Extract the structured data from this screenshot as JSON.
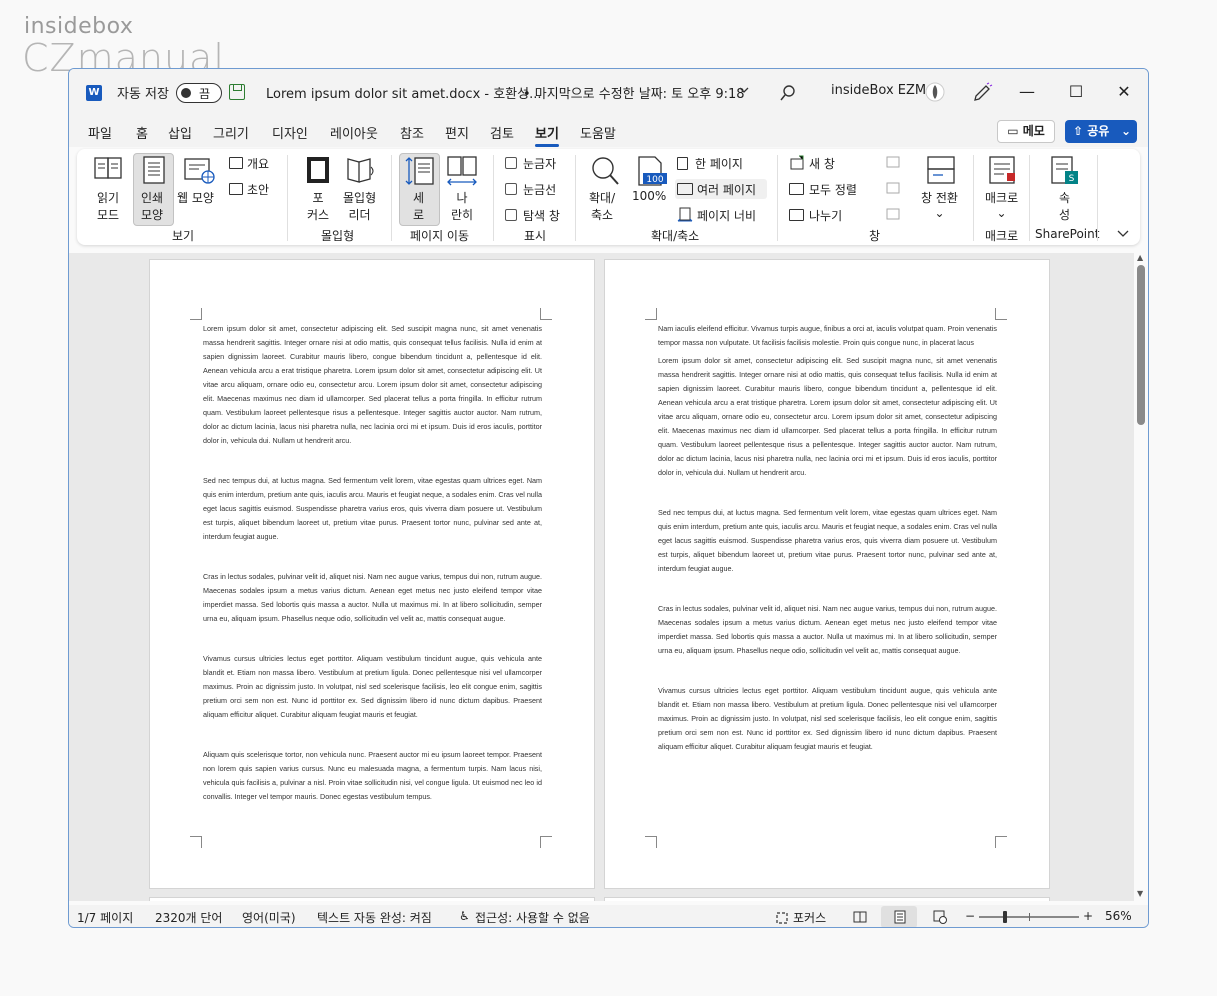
{
  "watermark": {
    "line1": "insidebox",
    "line2": "CZmanual"
  },
  "titlebar": {
    "app_icon": "W",
    "autosave_label": "자동 저장",
    "autosave_state": "끔",
    "doc_title": "Lorem ipsum dolor sit amet.docx  -  호환성...",
    "modified": "•  마지막으로 수정한 날짜: 토 오후 9:18",
    "user": "insideBox EZM",
    "minimize": "—",
    "maximize": "☐",
    "close": "✕"
  },
  "menu": {
    "tabs": [
      "파일",
      "홈",
      "삽입",
      "그리기",
      "디자인",
      "레이아웃",
      "참조",
      "편지",
      "검토",
      "보기",
      "도움말"
    ],
    "active_tab": "보기",
    "memo_label": "메모",
    "share_label": "공유"
  },
  "ribbon": {
    "view": {
      "read_mode_l1": "읽기",
      "read_mode_l2": "모드",
      "print_layout_l1": "인쇄",
      "print_layout_l2": "모양",
      "web_layout": "웹 모양",
      "outline": "개요",
      "draft": "초안",
      "group_label": "보기"
    },
    "immersive": {
      "focus_l1": "포",
      "focus_l2": "커스",
      "reader_l1": "몰입형",
      "reader_l2": "리더",
      "group_label": "몰입형"
    },
    "page_move": {
      "vertical_l1": "세",
      "vertical_l2": "로",
      "side_l1": "나",
      "side_l2": "란히",
      "group_label": "페이지 이동"
    },
    "show": {
      "ruler": "눈금자",
      "gridlines": "눈금선",
      "nav_pane": "탐색 창",
      "group_label": "표시"
    },
    "zoom": {
      "zoom_l1": "확대/",
      "zoom_l2": "축소",
      "hundred": "100%",
      "one_page": "한 페이지",
      "multi_page": "여러 페이지",
      "page_width": "페이지 너비",
      "group_label": "확대/축소"
    },
    "window": {
      "new_window": "새 창",
      "arrange_all": "모두 정렬",
      "split": "나누기",
      "switch_l1": "창 전환",
      "group_label": "창"
    },
    "macro": {
      "label": "매크로",
      "group_label": "매크로"
    },
    "sharepoint": {
      "label_l1": "속",
      "label_l2": "성",
      "group_label": "SharePoint"
    }
  },
  "page1": {
    "paragraphs": [
      "Lorem ipsum dolor sit amet, consectetur adipiscing elit. Sed suscipit magna nunc, sit amet venenatis massa hendrerit sagittis. Integer ornare nisi at odio mattis, quis consequat tellus facilisis. Nulla id enim at sapien dignissim laoreet. Curabitur mauris libero, congue bibendum tincidunt a, pellentesque id elit. Aenean vehicula arcu a erat tristique pharetra. Lorem ipsum dolor sit amet, consectetur adipiscing elit. Ut vitae arcu aliquam, ornare odio eu, consectetur arcu. Lorem ipsum dolor sit amet, consectetur adipiscing elit. Maecenas maximus nec diam id ullamcorper. Sed placerat tellus a porta fringilla. In efficitur rutrum quam. Vestibulum laoreet pellentesque risus a pellentesque. Integer sagittis auctor auctor. Nam rutrum, dolor ac dictum lacinia, lacus nisi pharetra nulla, nec lacinia orci mi et ipsum. Duis id eros iaculis, porttitor dolor in, vehicula dui. Nullam ut hendrerit arcu.",
      "Sed nec tempus dui, at luctus magna. Sed fermentum velit lorem, vitae egestas quam ultrices eget. Nam quis enim interdum, pretium ante quis, iaculis arcu. Mauris et feugiat neque, a sodales enim. Cras vel nulla eget lacus sagittis euismod. Suspendisse pharetra varius eros, quis viverra diam posuere ut. Vestibulum est turpis, aliquet bibendum laoreet ut, pretium vitae purus. Praesent tortor nunc, pulvinar sed ante at, interdum feugiat augue.",
      "Cras in lectus sodales, pulvinar velit id, aliquet nisi. Nam nec augue varius, tempus dui non, rutrum augue. Maecenas sodales ipsum a metus varius dictum. Aenean eget metus nec justo eleifend tempor vitae imperdiet massa. Sed lobortis quis massa a auctor. Nulla ut maximus mi. In at libero sollicitudin, semper urna eu, aliquam ipsum. Phasellus neque odio, sollicitudin vel velit ac, mattis consequat augue.",
      "Vivamus cursus ultricies lectus eget porttitor. Aliquam vestibulum tincidunt augue, quis vehicula ante blandit et. Etiam non massa libero. Vestibulum at pretium ligula. Donec pellentesque nisi vel ullamcorper maximus. Proin ac dignissim justo. In volutpat, nisl sed scelerisque facilisis, leo elit congue enim, sagittis pretium orci sem non est. Nunc id porttitor ex. Sed dignissim libero id nunc dictum dapibus. Praesent aliquam efficitur aliquet. Curabitur aliquam feugiat mauris et feugiat.",
      "Aliquam quis scelerisque tortor, non vehicula nunc. Praesent auctor mi eu ipsum laoreet tempor. Praesent non lorem quis sapien varius cursus. Nunc eu malesuada magna, a fermentum turpis. Nam lacus nisi, vehicula quis facilisis a, pulvinar a nisl. Proin vitae sollicitudin nisi, vel congue ligula. Ut euismod nec leo id convallis. Integer vel tempor mauris. Donec egestas vestibulum tempus."
    ]
  },
  "page2": {
    "paragraphs": [
      "Nam iaculis eleifend efficitur. Vivamus turpis augue, finibus a orci at, iaculis volutpat quam. Proin venenatis tempor massa non vulputate. Ut facilisis facilisis molestie. Proin quis congue nunc, in placerat lacus",
      "Lorem ipsum dolor sit amet, consectetur adipiscing elit. Sed suscipit magna nunc, sit amet venenatis massa hendrerit sagittis. Integer ornare nisi at odio mattis, quis consequat tellus facilisis. Nulla id enim at sapien dignissim laoreet. Curabitur mauris libero, congue bibendum tincidunt a, pellentesque id elit. Aenean vehicula arcu a erat tristique pharetra. Lorem ipsum dolor sit amet, consectetur adipiscing elit. Ut vitae arcu aliquam, ornare odio eu, consectetur arcu. Lorem ipsum dolor sit amet, consectetur adipiscing elit. Maecenas maximus nec diam id ullamcorper. Sed placerat tellus a porta fringilla. In efficitur rutrum quam. Vestibulum laoreet pellentesque risus a pellentesque. Integer sagittis auctor auctor. Nam rutrum, dolor ac dictum lacinia, lacus nisi pharetra nulla, nec lacinia orci mi et ipsum. Duis id eros iaculis, porttitor dolor in, vehicula dui. Nullam ut hendrerit arcu.",
      "Sed nec tempus dui, at luctus magna. Sed fermentum velit lorem, vitae egestas quam ultrices eget. Nam quis enim interdum, pretium ante quis, iaculis arcu. Mauris et feugiat neque, a sodales enim. Cras vel nulla eget lacus sagittis euismod. Suspendisse pharetra varius eros, quis viverra diam posuere ut. Vestibulum est turpis, aliquet bibendum laoreet ut, pretium vitae purus. Praesent tortor nunc, pulvinar sed ante at, interdum feugiat augue.",
      "Cras in lectus sodales, pulvinar velit id, aliquet nisi. Nam nec augue varius, tempus dui non, rutrum augue. Maecenas sodales ipsum a metus varius dictum. Aenean eget metus nec justo eleifend tempor vitae imperdiet massa. Sed lobortis quis massa a auctor. Nulla ut maximus mi. In at libero sollicitudin, semper urna eu, aliquam ipsum. Phasellus neque odio, sollicitudin vel velit ac, mattis consequat augue.",
      "Vivamus cursus ultricies lectus eget porttitor. Aliquam vestibulum tincidunt augue, quis vehicula ante blandit et. Etiam non massa libero. Vestibulum at pretium ligula. Donec pellentesque nisi vel ullamcorper maximus. Proin ac dignissim justo. In volutpat, nisl sed scelerisque facilisis, leo elit congue enim, sagittis pretium orci sem non est. Nunc id porttitor ex. Sed dignissim libero id nunc dictum dapibus. Praesent aliquam efficitur aliquet. Curabitur aliquam feugiat mauris et feugiat."
    ]
  },
  "statusbar": {
    "page": "1/7 페이지",
    "words": "2320개 단어",
    "language": "영어(미국)",
    "autocomplete": "텍스트 자동 완성: 켜짐",
    "accessibility": "접근성: 사용할 수 없음",
    "focus": "포커스",
    "zoom_minus": "−",
    "zoom_plus": "+",
    "zoom_level": "56%",
    "zoom_fraction": 0.56
  },
  "colors": {
    "accent": "#185abd",
    "window_border": "#6f9bd1"
  }
}
